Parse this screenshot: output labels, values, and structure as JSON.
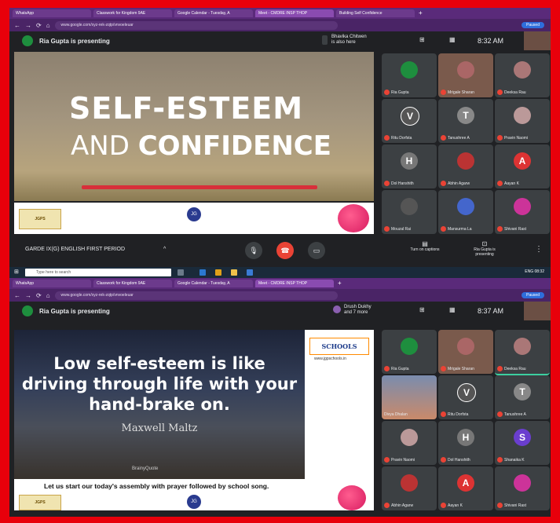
{
  "top": {
    "tabs": [
      "WhatsApp",
      "Classwork for Kingdom 9AE",
      "Google Calendar - Tuesday, A",
      "Meet - CMDRE INSP THOP",
      "Building Self Confidence"
    ],
    "url": "www.google.com/xyz-rek-zqtp/vnvoeleuar",
    "profile": "Paused",
    "presenting": "Ria Gupta is presenting",
    "notice": [
      "Bhavika Chitwen",
      "is also here"
    ],
    "time": "8:32 AM",
    "slide": {
      "title": "SELF-ESTEEM",
      "and": "AND ",
      "confidence": "CONFIDENCE"
    },
    "participants": [
      {
        "name": "Ria Gupta",
        "initial": "",
        "color": "#1e8e3e"
      },
      {
        "name": "Mrigale Sharan",
        "initial": "",
        "color": "#a66"
      },
      {
        "name": "Deeksa Rau",
        "initial": "",
        "color": "#a77"
      },
      {
        "name": "Ritu Dorfsta",
        "initial": "V",
        "color": "#555"
      },
      {
        "name": "Tanushree A",
        "initial": "T",
        "color": "#888"
      },
      {
        "name": "Pravin Naomi",
        "initial": "",
        "color": "#b99"
      },
      {
        "name": "Dol Hanshith",
        "initial": "H",
        "color": "#777"
      },
      {
        "name": "Abhin Agarw",
        "initial": "",
        "color": "#b33"
      },
      {
        "name": "Aayan K",
        "initial": "A",
        "color": "#d33"
      },
      {
        "name": "Mouzal Rai",
        "initial": "",
        "color": "#555"
      },
      {
        "name": "Mansurma La",
        "initial": "",
        "color": "#46c"
      },
      {
        "name": "Shivani Rast",
        "initial": "",
        "color": "#c39"
      }
    ],
    "meeting_title": "GARDE IX(G) ENGLISH FIRST PERIOD",
    "captions": "Turn on captions",
    "present_label": "Ria Gupta is presenting"
  },
  "taskbar": {
    "search": "Type here to search",
    "tray": "ENG 08:32"
  },
  "bottom": {
    "tabs": [
      "WhatsApp",
      "Classwork for Kingdom 9AE",
      "Google Calendar - Tuesday, A",
      "Meet - CMDRE INSP THOP"
    ],
    "url": "www.google.com/xyz-rek-zqtp/vnvoeleuar",
    "profile": "Paused",
    "presenting": "Ria Gupta is presenting",
    "notice": [
      "Drush Dukhy",
      "and 7 more"
    ],
    "time": "8:37 AM",
    "quote": {
      "line1": "Low self-esteem is like",
      "line2": "driving through life with your",
      "line3": "hand-brake on.",
      "author": "Maxwell Maltz",
      "credit": "BrainyQuote"
    },
    "brand": "SCHOOLS",
    "brand_url": "www.jgpschools.in",
    "assembly": "Let us start our today's assembly with prayer followed by school song.",
    "participants": [
      {
        "name": "Ria Gupta",
        "initial": "",
        "color": "#1e8e3e"
      },
      {
        "name": "Mrigale Sharan",
        "initial": "",
        "color": "#a66"
      },
      {
        "name": "Deeksa Rau",
        "initial": "",
        "color": "#a77"
      },
      {
        "name": "Divya Dhalan",
        "initial": "",
        "color": "#7a8cae"
      },
      {
        "name": "Ritu Dorfsta",
        "initial": "V",
        "color": "#555"
      },
      {
        "name": "Tanushree A",
        "initial": "T",
        "color": "#888"
      },
      {
        "name": "Pravin Naomi",
        "initial": "",
        "color": "#b99"
      },
      {
        "name": "Dol Hanshith",
        "initial": "H",
        "color": "#777"
      },
      {
        "name": "Shanaika K",
        "initial": "S",
        "color": "#6a3ecf"
      },
      {
        "name": "Abhin Agarw",
        "initial": "",
        "color": "#b33"
      },
      {
        "name": "Aayan K",
        "initial": "A",
        "color": "#d33"
      },
      {
        "name": "Shivani Rast",
        "initial": "",
        "color": "#c39"
      }
    ]
  },
  "colors": {
    "border": "#e8000b",
    "meet_bg": "#202124",
    "tile_bg": "#3c4043",
    "mic_off": "#ea4335",
    "accent_line": "#d8303a"
  }
}
